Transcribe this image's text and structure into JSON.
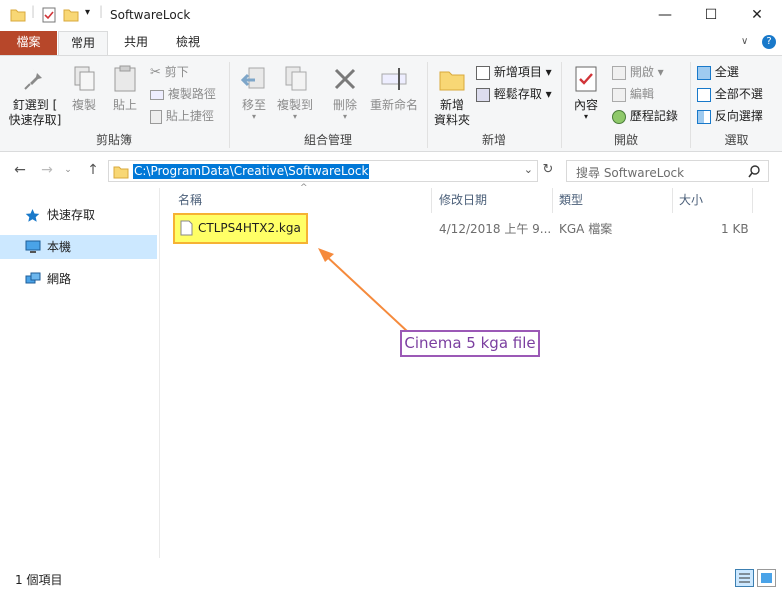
{
  "window": {
    "title": "SoftwareLock",
    "minimize": "—",
    "maximize": "☐",
    "close": "✕"
  },
  "tabs": {
    "file": "檔案",
    "home": "常用",
    "share": "共用",
    "view": "檢視"
  },
  "ribbon": {
    "clipboard": {
      "label": "剪貼簿",
      "pin": "釘選到 [\n快速存取]",
      "copy": "複製",
      "paste": "貼上",
      "cut": "剪下",
      "copy_path": "複製路徑",
      "paste_shortcut": "貼上捷徑"
    },
    "organize": {
      "label": "組合管理",
      "move_to": "移至",
      "copy_to": "複製到",
      "delete": "刪除",
      "rename": "重新命名"
    },
    "new": {
      "label": "新增",
      "new_folder": "新增\n資料夾",
      "new_item": "新增項目 ▾",
      "easy_access": "輕鬆存取 ▾"
    },
    "open": {
      "label": "開啟",
      "properties": "內容",
      "open": "開啟 ▾",
      "edit": "編輯",
      "history": "歷程記錄"
    },
    "select": {
      "label": "選取",
      "select_all": "全選",
      "select_none": "全部不選",
      "invert": "反向選擇"
    }
  },
  "address": {
    "path": "C:\\ProgramData\\Creative\\SoftwareLock",
    "search_placeholder": "搜尋 SoftwareLock"
  },
  "nav": {
    "quick_access": "快速存取",
    "this_pc": "本機",
    "network": "網路"
  },
  "columns": {
    "name": "名稱",
    "modified": "修改日期",
    "type": "類型",
    "size": "大小"
  },
  "files": [
    {
      "name": "CTLPS4HTX2.kga",
      "modified": "4/12/2018 上午 9...",
      "type": "KGA 檔案",
      "size": "1 KB"
    }
  ],
  "annotation": {
    "text": "Cinema 5 kga file",
    "color": "#9b59b6",
    "arrow_color": "#f58a3c"
  },
  "status": {
    "count": "1 個項目"
  },
  "colors": {
    "file_tab": "#b7472a",
    "selection": "#0078d7",
    "highlight": "#ffff66"
  }
}
